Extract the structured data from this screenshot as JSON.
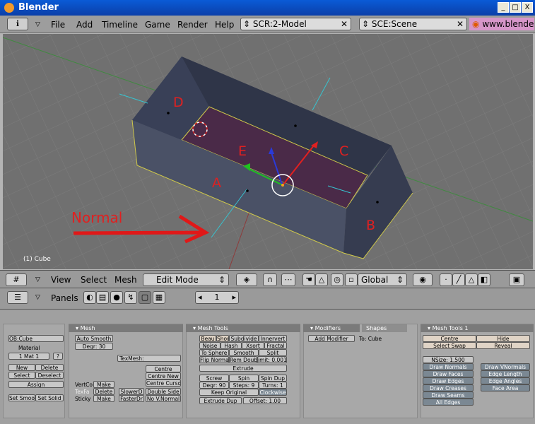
{
  "window": {
    "title": "Blender",
    "controls": [
      "_",
      "□",
      "X"
    ]
  },
  "menubar": {
    "items": [
      "File",
      "Add",
      "Timeline",
      "Game",
      "Render",
      "Help"
    ],
    "screen": "SCR:2-Model",
    "scene": "SCE:Scene",
    "website": "www.blende"
  },
  "viewport": {
    "object_label": "(1) Cube",
    "face_labels": [
      "A",
      "B",
      "C",
      "D",
      "E"
    ],
    "annotation": "Normal"
  },
  "view_header": {
    "view": "View",
    "select": "Select",
    "mesh": "Mesh",
    "mode": "Edit Mode",
    "orientation": "Global"
  },
  "buttons_header": {
    "panels": "Panels",
    "frame": "1"
  },
  "link_panel": {
    "ob": "OB:Cube",
    "material": "Material",
    "mat_index": "1 Mat 1",
    "question": "?",
    "new": "New",
    "delete": "Delete",
    "select": "Select",
    "deselect": "Deselect",
    "assign": "Assign",
    "set_smooth": "Set Smoo",
    "set_solid": "Set Solid"
  },
  "mesh_panel": {
    "title": "Mesh",
    "auto_smooth": "Auto Smooth",
    "degr": "Degr: 30",
    "texmesh": "TexMesh:",
    "vertcol": "VertCo",
    "make1": "Make",
    "texfa": "TexFa",
    "delete": "Delete",
    "sticky": "Sticky",
    "make2": "Make",
    "centre": "Centre",
    "centre_new": "Centre New",
    "centre_cursor": "Centre Curso",
    "slower": "SlowerD",
    "faster": "FasterDr",
    "double_side": "Double Side",
    "no_vnormal": "No V.Normal"
  },
  "mesh_tools": {
    "title": "Mesh Tools",
    "row1": [
      "Beau",
      "Shor",
      "Subdivide",
      "Innervert"
    ],
    "row2": [
      "Noise",
      "Hash",
      "Xsort",
      "Fractal"
    ],
    "row3": [
      "To Sphere",
      "Smooth",
      "Split"
    ],
    "row4": [
      "Flip Normal",
      "Rem Doubl",
      "imit: 0.001"
    ],
    "extrude": "Extrude",
    "row6": [
      "Screw",
      "Spin",
      "Spin Dup"
    ],
    "row7": [
      "Degr: 90",
      "Steps: 9",
      "Turns: 1"
    ],
    "keep_original": "Keep Original",
    "clockwise": "Clockwise",
    "extrude_dup": "Extrude Dup",
    "offset": "Offset: 1.00"
  },
  "modifiers": {
    "tab1": "Modifiers",
    "tab2": "Shapes",
    "add_modifier": "Add Modifier",
    "to": "To: Cube"
  },
  "mesh_tools1": {
    "title": "Mesh Tools 1",
    "centre": "Centre",
    "hide": "Hide",
    "select_swap": "Select Swap",
    "reveal": "Reveal",
    "nsize": "NSize: 1.500",
    "draw_normals": "Draw Normals",
    "draw_faces": "Draw Faces",
    "draw_edges": "Draw Edges",
    "draw_creases": "Draw Creases",
    "draw_seams": "Draw Seams",
    "all_edges": "All Edges",
    "draw_vnormals": "Draw VNormals",
    "edge_length": "Edge Length",
    "edge_angles": "Edge Angles",
    "face_area": "Face Area"
  }
}
